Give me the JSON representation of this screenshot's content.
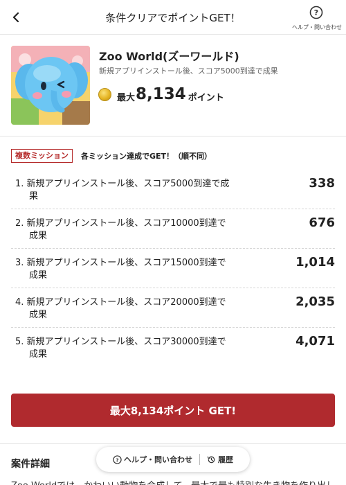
{
  "header": {
    "title": "条件クリアでポイントGET！",
    "help_label": "ヘルプ・問い合わせ"
  },
  "app": {
    "name": "Zoo World(ズーワールド)",
    "description": "新規アプリインストール後、スコア5000到達で成果",
    "reward_prefix": "最大",
    "reward_value": "8,134",
    "reward_suffix": "ポイント",
    "icon": "elephant-app-icon"
  },
  "missions": {
    "badge": "複数ミッション",
    "note": "各ミッション達成でGET！（順不同）",
    "items": [
      {
        "line1": "1. 新規アプリインストール後、スコア5000到達で成",
        "line2": "果",
        "points": "338"
      },
      {
        "line1": "2. 新規アプリインストール後、スコア10000到達で",
        "line2": "成果",
        "points": "676"
      },
      {
        "line1": "3. 新規アプリインストール後、スコア15000到達で",
        "line2": "成果",
        "points": "1,014"
      },
      {
        "line1": "4. 新規アプリインストール後、スコア20000到達で",
        "line2": "成果",
        "points": "2,035"
      },
      {
        "line1": "5. 新規アプリインストール後、スコア30000到達で",
        "line2": "成果",
        "points": "4,071"
      }
    ]
  },
  "cta": {
    "label": "最大8,134ポイント GET!"
  },
  "details": {
    "title": "案件詳細",
    "text": "Zoo Worldでは、かわいい動物を合成して、最大で最も特別な生き物を作り出し"
  },
  "floating_bar": {
    "help_label": "ヘルプ・問い合わせ",
    "history_label": "履歴"
  },
  "colors": {
    "accent": "#b02a2e",
    "badge": "#b52b2b"
  }
}
